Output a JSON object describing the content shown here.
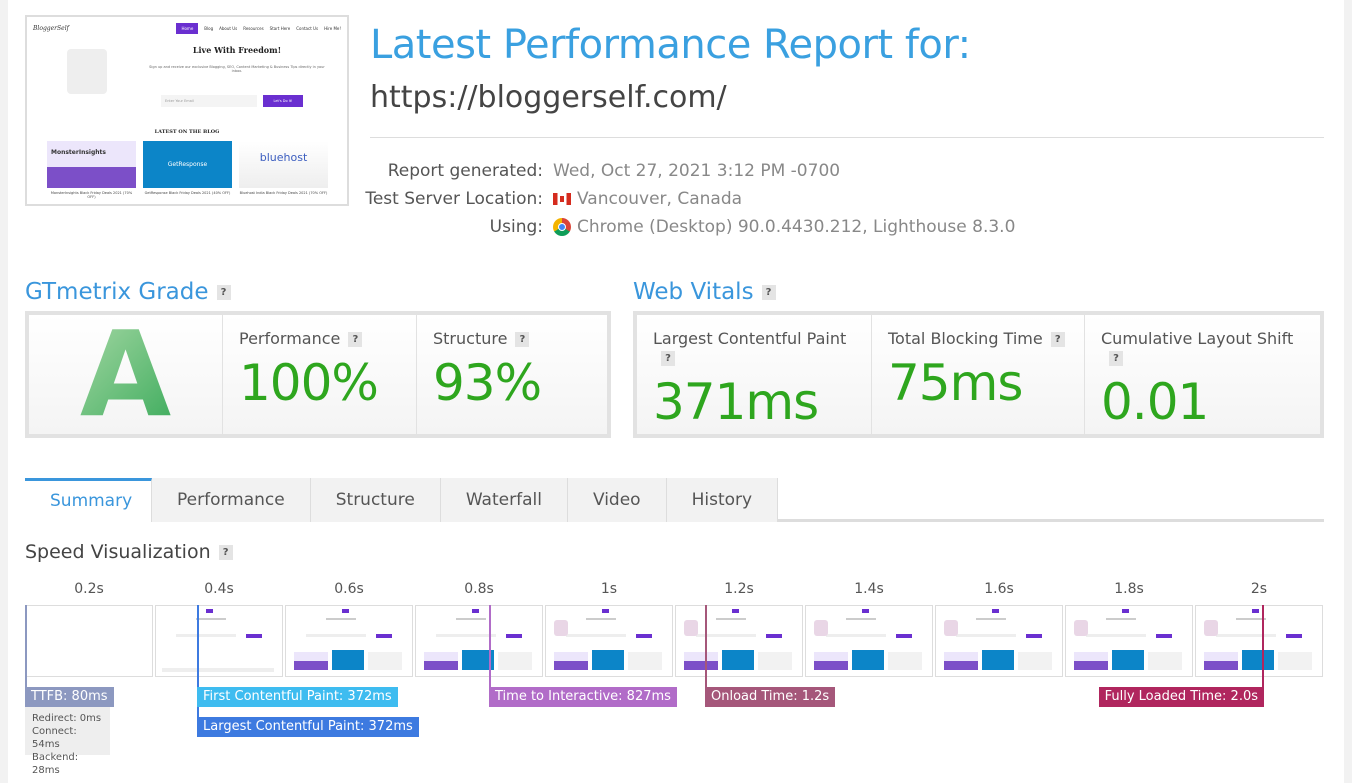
{
  "thumbnail": {
    "site_logo": "BloggerSelf",
    "nav": [
      "Home",
      "Blog",
      "About Us",
      "Resources",
      "Start Here",
      "Contact Us",
      "Hire Me!"
    ],
    "headline": "Live With Freedom!",
    "subtext": "Sign up and receive our exclusive Blogging, SEO, Content Marketing & Business Tips directly in your inbox.",
    "email_placeholder": "Enter Your Email",
    "cta": "Let's Do It!",
    "blog_heading": "LATEST ON THE BLOG",
    "cards": [
      {
        "brand": "MonsterInsights",
        "title": "MonsterInsights Black Friday Deals 2021 (70% OFF)"
      },
      {
        "brand": "GetResponse",
        "title": "GetResponse Black Friday Deals 2021 (40% OFF)"
      },
      {
        "brand": "bluehost",
        "title": "Bluehost India Black Friday Deals 2021 (70% OFF)"
      }
    ]
  },
  "header": {
    "title": "Latest Performance Report for:",
    "url": "https://bloggerself.com/"
  },
  "meta": {
    "report_generated_label": "Report generated:",
    "report_generated": "Wed, Oct 27, 2021 3:12 PM -0700",
    "location_label": "Test Server Location:",
    "location": "Vancouver, Canada",
    "using_label": "Using:",
    "using": "Chrome (Desktop) 90.0.4430.212, Lighthouse 8.3.0"
  },
  "grade": {
    "title": "GTmetrix Grade",
    "help": "?",
    "letter": "A",
    "performance_label": "Performance",
    "performance": "100%",
    "structure_label": "Structure",
    "structure": "93%"
  },
  "vitals": {
    "title": "Web Vitals",
    "help": "?",
    "lcp_label": "Largest Contentful Paint",
    "lcp": "371ms",
    "tbt_label": "Total Blocking Time",
    "tbt": "75ms",
    "cls_label": "Cumulative Layout Shift",
    "cls": "0.01"
  },
  "tabs": [
    "Summary",
    "Performance",
    "Structure",
    "Waterfall",
    "Video",
    "History"
  ],
  "active_tab": "Summary",
  "speed": {
    "title": "Speed Visualization",
    "help": "?",
    "ticks": [
      "0.2s",
      "0.4s",
      "0.6s",
      "0.8s",
      "1s",
      "1.2s",
      "1.4s",
      "1.6s",
      "1.8s",
      "2s"
    ],
    "ttfb": "TTFB: 80ms",
    "redirect": "Redirect: 0ms",
    "connect": "Connect: 54ms",
    "backend": "Backend: 28ms",
    "fcp": "First Contentful Paint: 372ms",
    "lcp": "Largest Contentful Paint: 372ms",
    "tti": "Time to Interactive: 827ms",
    "onload": "Onload Time: 1.2s",
    "fully": "Fully Loaded Time: 2.0s"
  },
  "colors": {
    "accent": "#3a96dc",
    "good": "#2ea61e",
    "ttfb": "#8c98c0",
    "fcp": "#3ebcf0",
    "lcp": "#3d7ae0",
    "tti": "#b16cc8",
    "onload": "#a5577a",
    "fully": "#b0265e"
  }
}
